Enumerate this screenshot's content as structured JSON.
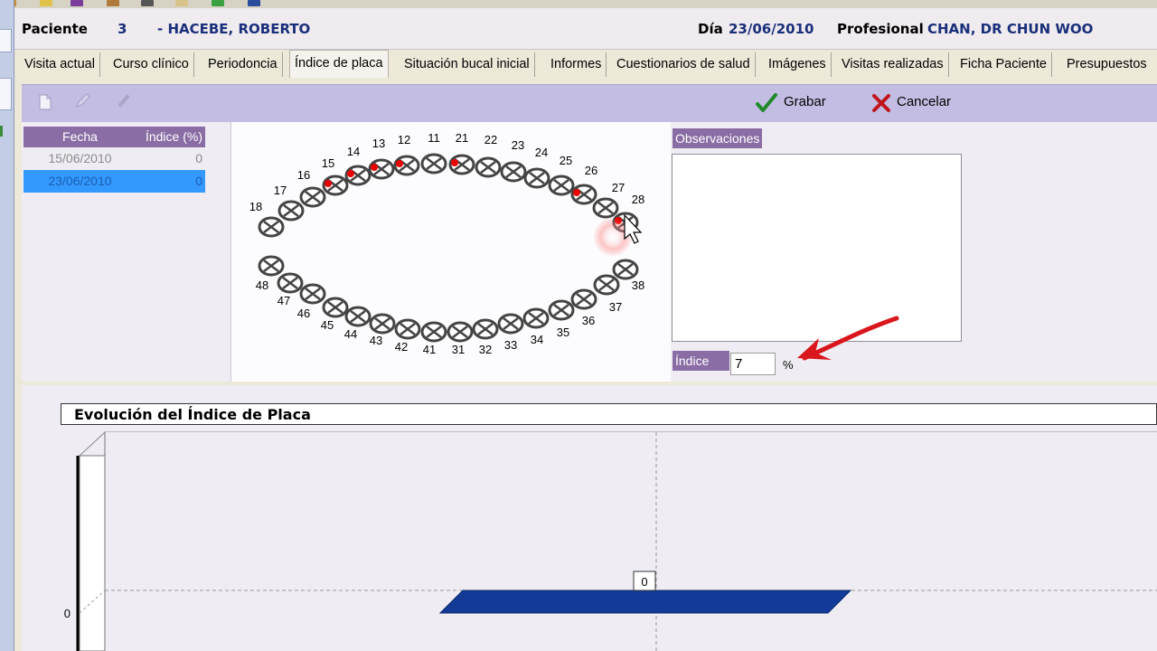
{
  "header": {
    "paciente_label": "Paciente",
    "paciente_num": "3",
    "paciente_name": "- HACEBE, ROBERTO",
    "dia_label": "Día",
    "dia_value": "23/06/2010",
    "profesional_label": "Profesional",
    "profesional_value": "CHAN, DR CHUN WOO"
  },
  "tabs": [
    {
      "label": "Visita actual"
    },
    {
      "label": "Curso clínico"
    },
    {
      "label": "Periodoncia"
    },
    {
      "label": "Índice de placa",
      "active": true
    },
    {
      "label": "Situación bucal inicial"
    },
    {
      "label": "Informes"
    },
    {
      "label": "Cuestionarios de salud"
    },
    {
      "label": "Imágenes"
    },
    {
      "label": "Visitas realizadas"
    },
    {
      "label": "Ficha Paciente"
    },
    {
      "label": "Presupuestos"
    }
  ],
  "toolbar": {
    "save_label": "Grabar",
    "cancel_label": "Cancelar",
    "icons": [
      "new-document-icon",
      "edit-pen-icon",
      "delete-icon",
      "checkmark-icon",
      "x-mark-icon"
    ]
  },
  "records": {
    "col_fecha": "Fecha",
    "col_indice": "Índice (%)",
    "rows": [
      {
        "fecha": "15/06/2010",
        "indice": "0"
      },
      {
        "fecha": "23/06/2010",
        "indice": "0",
        "selected": true
      }
    ]
  },
  "odontogram": {
    "upper_labels": [
      "18",
      "17",
      "16",
      "15",
      "14",
      "13",
      "12",
      "11",
      "21",
      "22",
      "23",
      "24",
      "25",
      "26",
      "27",
      "28"
    ],
    "lower_labels": [
      "48",
      "47",
      "46",
      "45",
      "44",
      "43",
      "42",
      "41",
      "31",
      "32",
      "33",
      "34",
      "35",
      "36",
      "37",
      "38"
    ],
    "marked_teeth": [
      "15",
      "14",
      "13",
      "12",
      "21",
      "26",
      "28"
    ],
    "plaque_color": "#e80000"
  },
  "observaciones": {
    "label": "Observaciones",
    "value": ""
  },
  "indice": {
    "label": "Índice",
    "value": "7",
    "unit": "%"
  },
  "chart_data": {
    "type": "bar",
    "title": "Evolución del Índice de Placa",
    "categories": [
      "",
      ""
    ],
    "series": [
      {
        "values": [
          0,
          0
        ],
        "color": "#123a96"
      }
    ],
    "data_labels": [
      "0"
    ],
    "yticks": [
      "0"
    ],
    "ylim": [
      0,
      1
    ],
    "grid": true,
    "legend": "none",
    "bar_label": "0",
    "y_tick_label": "0"
  },
  "colors": {
    "toolbar": "#c3bde3",
    "header_purple": "#8a6da4",
    "selection": "#3399ff",
    "arrow": "#d9161b"
  }
}
